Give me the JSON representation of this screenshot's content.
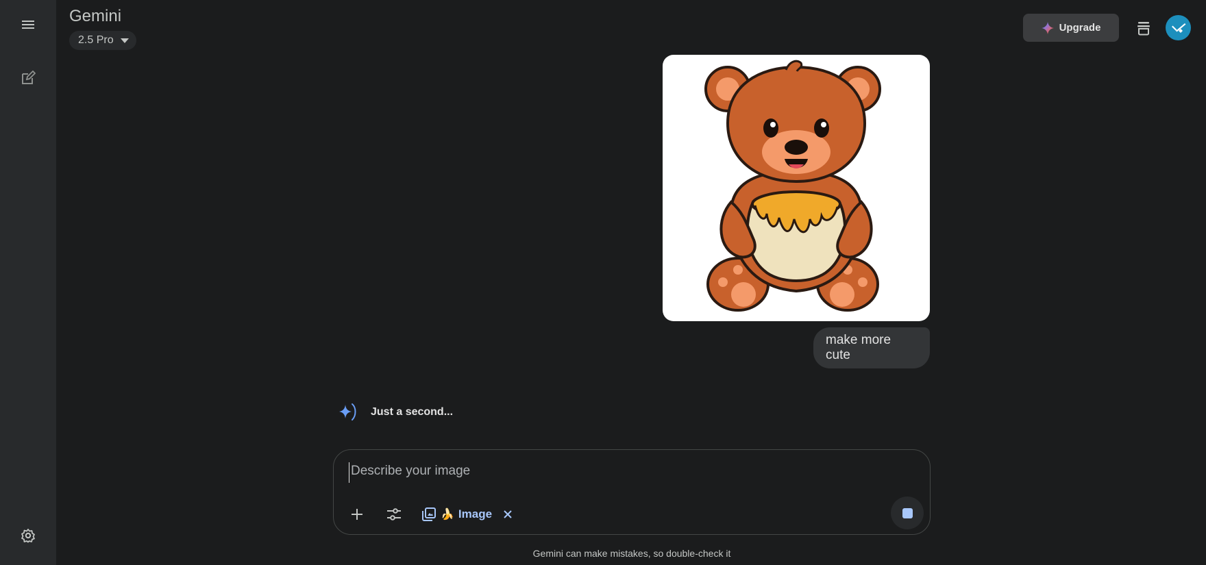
{
  "header": {
    "brand": "Gemini",
    "model": "2.5 Pro",
    "upgrade_label": "Upgrade"
  },
  "sidebar": {
    "items": [
      {
        "icon": "menu-icon"
      },
      {
        "icon": "new-chat-icon"
      },
      {
        "icon": "settings-icon"
      }
    ]
  },
  "conversation": {
    "user_image": {
      "subject": "cartoon-bear-with-honey-pot"
    },
    "user_message": "make more cute",
    "assistant_status": "Just a second..."
  },
  "composer": {
    "placeholder": "Describe your image",
    "tool_chip_label": "Image",
    "tool_chip_emoji": "🍌"
  },
  "footer": {
    "disclaimer": "Gemini can make mistakes, so double-check it"
  },
  "colors": {
    "background": "#1b1c1d",
    "sidebar": "#282a2c",
    "accent": "#a8c7fa",
    "avatar": "#1d8fbd"
  }
}
